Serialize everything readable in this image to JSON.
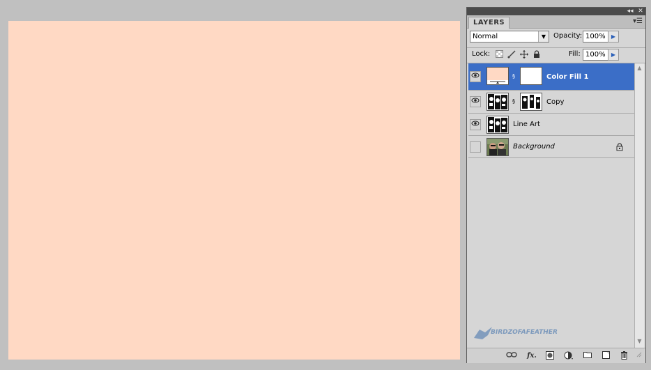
{
  "panel": {
    "tab_label": "LAYERS",
    "collapse_glyph": "◂◂",
    "close_glyph": "✕",
    "menu_glyph": "▾☰"
  },
  "blend_mode": {
    "value": "Normal",
    "dropdown_glyph": "▼"
  },
  "opacity": {
    "label": "Opacity:",
    "value": "100%"
  },
  "lock": {
    "label": "Lock:"
  },
  "fill": {
    "label": "Fill:",
    "value": "100%"
  },
  "arrow_glyph": "▶",
  "layers": [
    {
      "name": "Color Fill 1",
      "visible": true,
      "selected": true,
      "has_mask": true,
      "kind": "color-fill",
      "swatch": "#ffd9c4",
      "locked": false
    },
    {
      "name": "Copy",
      "visible": true,
      "selected": false,
      "has_mask": true,
      "kind": "line-art",
      "locked": false
    },
    {
      "name": "Line Art",
      "visible": true,
      "selected": false,
      "has_mask": false,
      "kind": "line-art",
      "locked": false
    },
    {
      "name": "Background",
      "visible": false,
      "selected": false,
      "has_mask": false,
      "kind": "photo",
      "locked": true
    }
  ],
  "watermark": {
    "text": "BIRDZOFAFEATHER"
  },
  "canvas": {
    "color": "#ffd9c4"
  },
  "colors": {
    "selection": "#3b6ec7",
    "panel_bg": "#d6d6d6",
    "workspace": "#c0c0c0"
  },
  "eye_glyph": "👁",
  "chain_glyph": "§",
  "lock_glyph": "🔒",
  "scroll": {
    "up_glyph": "▲",
    "down_glyph": "▼"
  },
  "bottom_icons": [
    "link-layers-icon",
    "fx-icon",
    "add-mask-icon",
    "adjustment-layer-icon",
    "new-group-icon",
    "new-layer-icon",
    "delete-layer-icon"
  ],
  "bottom_labels": {
    "fx": "fx."
  }
}
